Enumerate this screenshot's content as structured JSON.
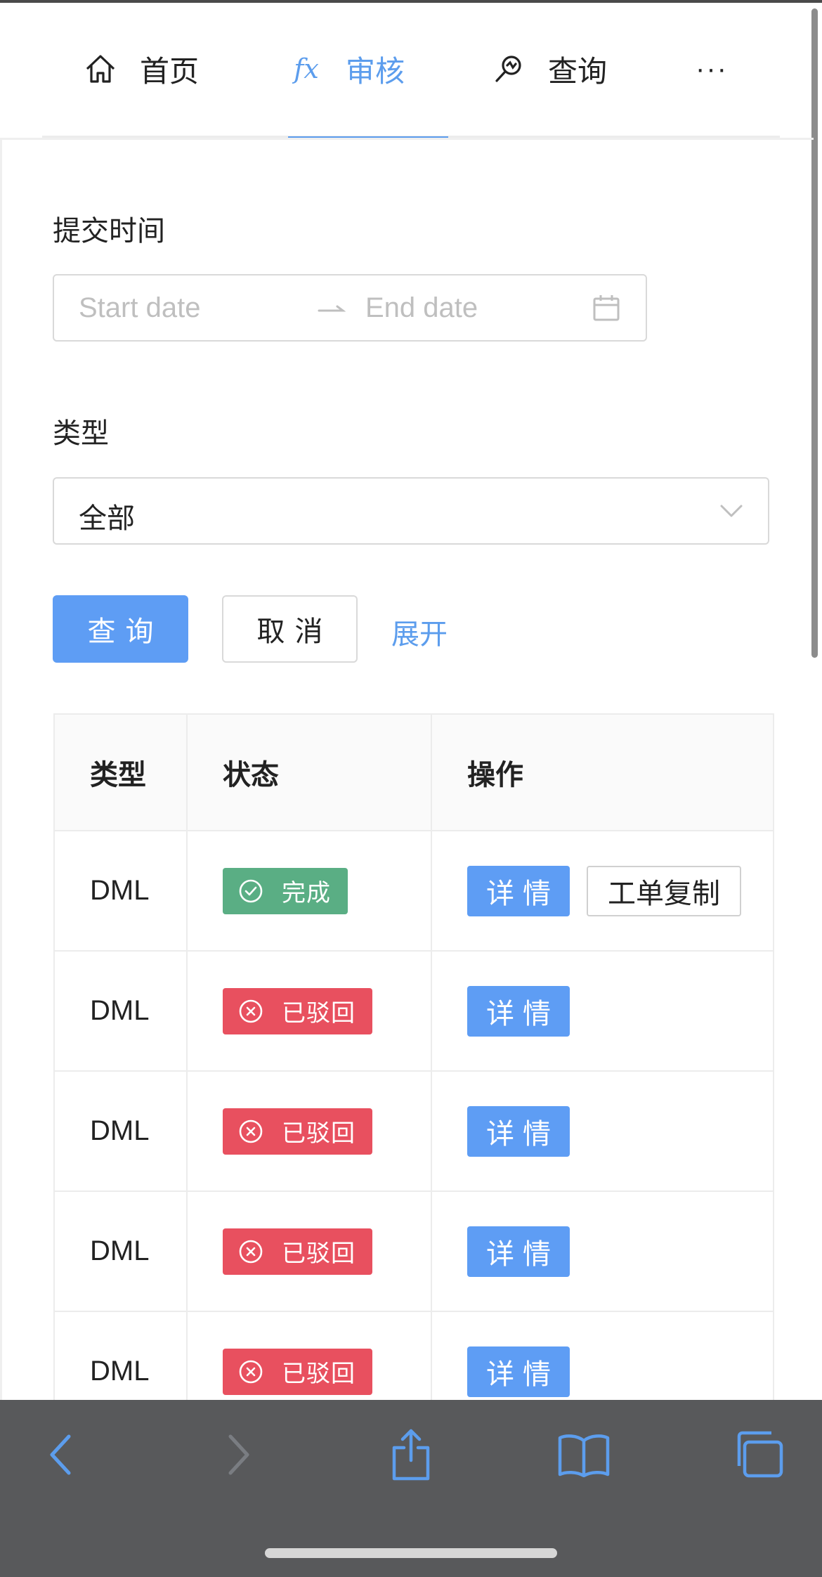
{
  "nav": {
    "items": [
      {
        "label": "首页",
        "icon": "home-icon"
      },
      {
        "label": "审核",
        "icon": "fx-icon",
        "icon_text": "fx",
        "active": true
      },
      {
        "label": "查询",
        "icon": "search-icon"
      }
    ],
    "more": "···"
  },
  "filter": {
    "date_label": "提交时间",
    "start_placeholder": "Start date",
    "end_placeholder": "End date",
    "range_separator": "→",
    "type_label": "类型",
    "type_value": "全部",
    "search_button": "查询",
    "cancel_button": "取消",
    "expand_link": "展开"
  },
  "table": {
    "headers": [
      "类型",
      "状态",
      "操作"
    ],
    "rows": [
      {
        "type": "DML",
        "status": "完成",
        "status_kind": "success",
        "actions": [
          "详情",
          "工单复制"
        ]
      },
      {
        "type": "DML",
        "status": "已驳回",
        "status_kind": "rejected",
        "actions": [
          "详情"
        ]
      },
      {
        "type": "DML",
        "status": "已驳回",
        "status_kind": "rejected",
        "actions": [
          "详情"
        ]
      },
      {
        "type": "DML",
        "status": "已驳回",
        "status_kind": "rejected",
        "actions": [
          "详情"
        ]
      },
      {
        "type": "DML",
        "status": "已驳回",
        "status_kind": "rejected",
        "actions": [
          "详情"
        ]
      }
    ]
  },
  "browser_bar": {
    "buttons": [
      "back-icon",
      "forward-icon",
      "share-icon",
      "bookmarks-icon",
      "tabs-icon"
    ]
  },
  "colors": {
    "accent": "#5c9ded",
    "primary_button": "#5e9df4",
    "success_tag": "#5aae84",
    "rejected_tag": "#e8505f",
    "toolbar": "#58595b"
  }
}
